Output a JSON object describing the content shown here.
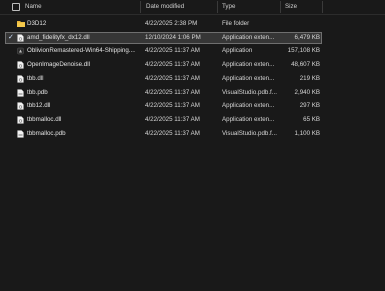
{
  "columns": {
    "name": "Name",
    "date": "Date modified",
    "type": "Type",
    "size": "Size"
  },
  "files": [
    {
      "name": "D3D12",
      "date": "4/22/2025 2:38 PM",
      "type": "File folder",
      "size": "",
      "icon": "folder-icon",
      "selected": false
    },
    {
      "name": "amd_fidelityfx_dx12.dll",
      "date": "12/10/2024 1:06 PM",
      "type": "Application exten...",
      "size": "6,479 KB",
      "icon": "dll-file-icon",
      "selected": true
    },
    {
      "name": "OblivionRemastered-Win64-Shipping....",
      "date": "4/22/2025 11:37 AM",
      "type": "Application",
      "size": "157,108 KB",
      "icon": "app-icon",
      "selected": false
    },
    {
      "name": "OpenImageDenoise.dll",
      "date": "4/22/2025 11:37 AM",
      "type": "Application exten...",
      "size": "48,607 KB",
      "icon": "dll-file-icon",
      "selected": false
    },
    {
      "name": "tbb.dll",
      "date": "4/22/2025 11:37 AM",
      "type": "Application exten...",
      "size": "219 KB",
      "icon": "dll-file-icon",
      "selected": false
    },
    {
      "name": "tbb.pdb",
      "date": "4/22/2025 11:37 AM",
      "type": "VisualStudio.pdb.f...",
      "size": "2,940 KB",
      "icon": "pdb-file-icon",
      "selected": false
    },
    {
      "name": "tbb12.dll",
      "date": "4/22/2025 11:37 AM",
      "type": "Application exten...",
      "size": "297 KB",
      "icon": "dll-file-icon",
      "selected": false
    },
    {
      "name": "tbbmalloc.dll",
      "date": "4/22/2025 11:37 AM",
      "type": "Application exten...",
      "size": "65 KB",
      "icon": "dll-file-icon",
      "selected": false
    },
    {
      "name": "tbbmalloc.pdb",
      "date": "4/22/2025 11:37 AM",
      "type": "VisualStudio.pdb.f...",
      "size": "1,100 KB",
      "icon": "pdb-file-icon",
      "selected": false
    }
  ]
}
